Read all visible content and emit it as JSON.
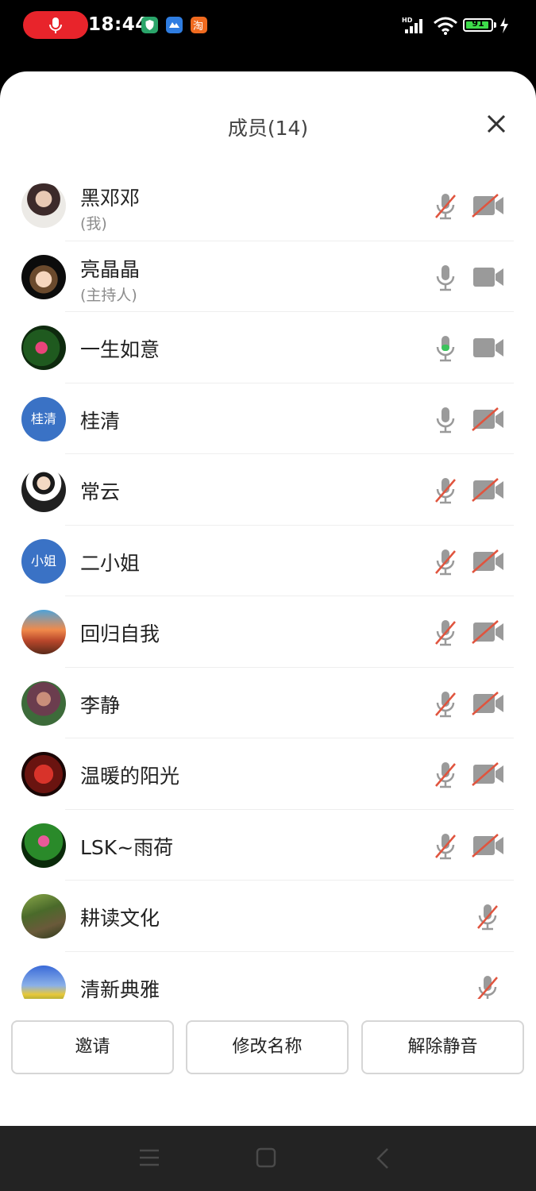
{
  "status_bar": {
    "time": "18:44",
    "battery": "91"
  },
  "sheet": {
    "title": "成员(14)"
  },
  "members": [
    {
      "name": "黑邓邓",
      "subtitle": "(我)",
      "mic": "muted",
      "cam": "off"
    },
    {
      "name": "亮晶晶",
      "subtitle": "(主持人)",
      "mic": "on",
      "cam": "on"
    },
    {
      "name": "一生如意",
      "subtitle": "",
      "mic": "speaking",
      "cam": "on"
    },
    {
      "name": "桂清",
      "subtitle": "",
      "avatar_text": "桂清",
      "mic": "on",
      "cam": "off"
    },
    {
      "name": "常云",
      "subtitle": "",
      "mic": "muted",
      "cam": "off"
    },
    {
      "name": "二小姐",
      "subtitle": "",
      "avatar_text": "小姐",
      "mic": "muted",
      "cam": "off"
    },
    {
      "name": "回归自我",
      "subtitle": "",
      "mic": "muted",
      "cam": "off"
    },
    {
      "name": "李静",
      "subtitle": "",
      "mic": "muted",
      "cam": "off"
    },
    {
      "name": "温暖的阳光",
      "subtitle": "",
      "mic": "muted",
      "cam": "off"
    },
    {
      "name": "LSK~雨荷",
      "subtitle": "",
      "mic": "muted",
      "cam": "off"
    },
    {
      "name": "耕读文化",
      "subtitle": "",
      "mic": "muted",
      "cam": "none"
    },
    {
      "name": "清新典雅",
      "subtitle": "",
      "mic": "muted",
      "cam": "none"
    }
  ],
  "actions": {
    "invite": "邀请",
    "rename": "修改名称",
    "unmute": "解除静音"
  },
  "colors": {
    "accent_blue": "#3a72c5",
    "mute_red": "#e0543e",
    "speaking_green": "#3cc35c",
    "icon_gray": "#9a9a9a"
  }
}
